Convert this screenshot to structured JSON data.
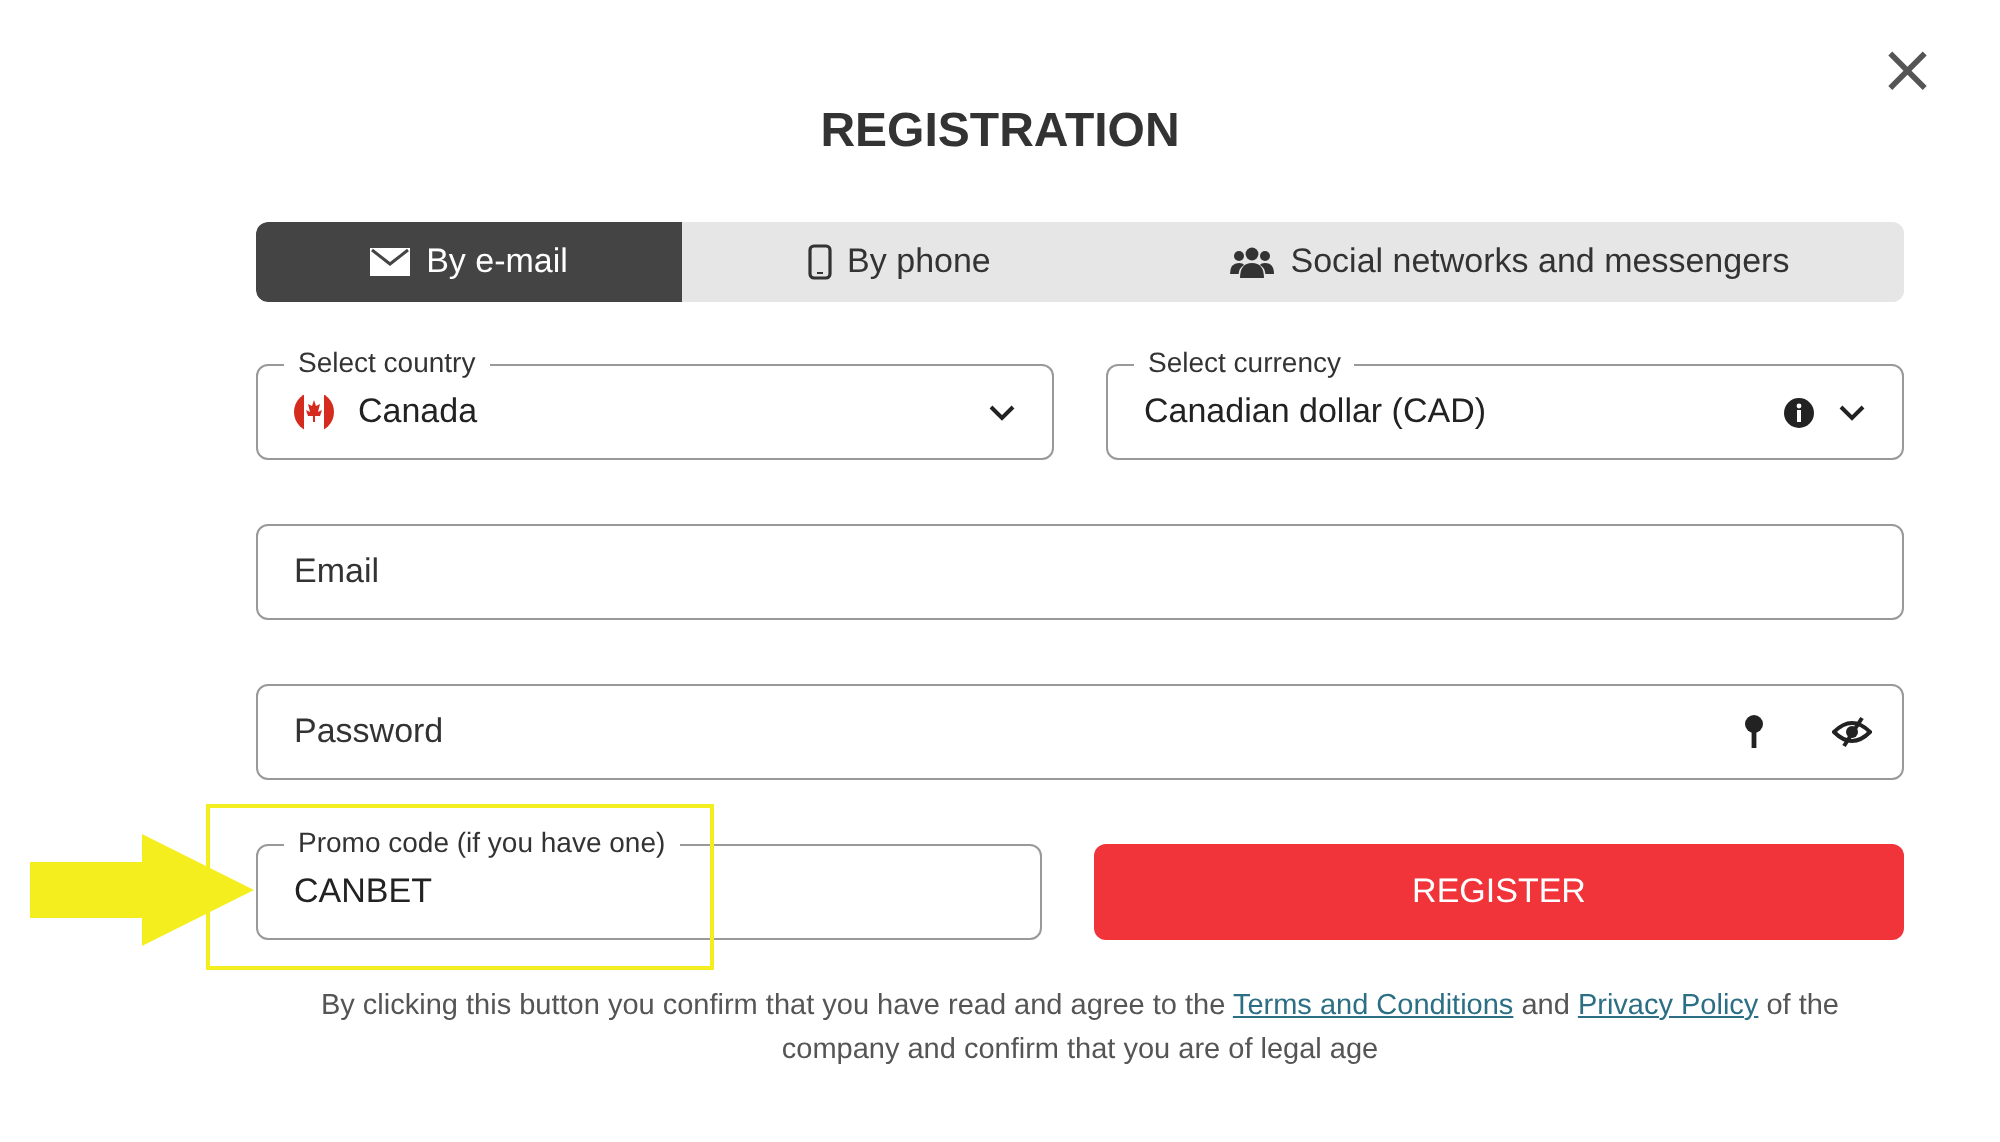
{
  "dialog": {
    "title": "REGISTRATION",
    "close": "×"
  },
  "tabs": [
    {
      "label": "By e-mail",
      "selected": true
    },
    {
      "label": "By phone",
      "selected": false
    },
    {
      "label": "Social networks and messengers",
      "selected": false
    }
  ],
  "country": {
    "label": "Select country",
    "value": "Canada"
  },
  "currency": {
    "label": "Select currency",
    "value": "Canadian dollar (CAD)"
  },
  "email": {
    "placeholder": "Email"
  },
  "password": {
    "placeholder": "Password"
  },
  "promo": {
    "label": "Promo code (if you have one)",
    "value": "CANBET",
    "highlighted": true
  },
  "register_button": "REGISTER",
  "disclaimer": [
    {
      "kind": "text",
      "text": "By clicking this button you confirm that you have read and agree to the "
    },
    {
      "kind": "link",
      "text": "Terms and Conditions"
    },
    {
      "kind": "text",
      "text": " and "
    },
    {
      "kind": "link",
      "text": "Privacy Policy"
    },
    {
      "kind": "text",
      "text": " of the company and confirm that you are of legal age"
    }
  ]
}
